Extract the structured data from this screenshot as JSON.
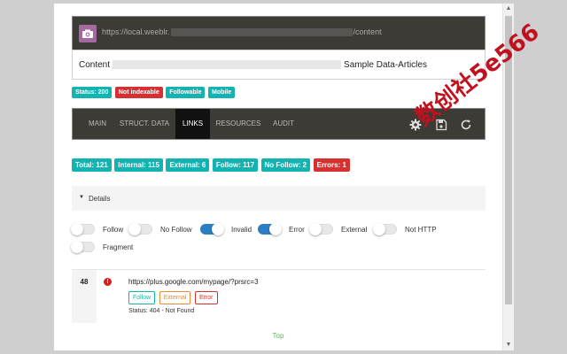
{
  "address": {
    "prefix": "https://local.weeblr.",
    "suffix": "/content"
  },
  "page_title": {
    "prefix": "Content",
    "suffix": "Sample Data-Articles"
  },
  "status_badges": [
    {
      "label": "Status: 200",
      "color": "#12b3b0"
    },
    {
      "label": "Not indexable",
      "color": "#d73030"
    },
    {
      "label": "Followable",
      "color": "#12b3b0"
    },
    {
      "label": "Mobile",
      "color": "#12b3b0"
    }
  ],
  "tabs": [
    {
      "label": "MAIN"
    },
    {
      "label": "STRUCT. DATA"
    },
    {
      "label": "LINKS"
    },
    {
      "label": "RESOURCES"
    },
    {
      "label": "AUDIT"
    }
  ],
  "active_tab": "LINKS",
  "toolbar_icons": [
    "gear-icon",
    "save-icon",
    "refresh-icon"
  ],
  "stats": [
    {
      "label": "Total: 121",
      "color": "#12b3b0"
    },
    {
      "label": "Internal: 115",
      "color": "#12b3b0"
    },
    {
      "label": "External: 6",
      "color": "#12b3b0"
    },
    {
      "label": "Follow: 117",
      "color": "#12b3b0"
    },
    {
      "label": "No Follow: 2",
      "color": "#12b3b0"
    },
    {
      "label": "Errors: 1",
      "color": "#d73030"
    }
  ],
  "details": {
    "label": "Details"
  },
  "filters": [
    {
      "label": "Follow",
      "on": false
    },
    {
      "label": "No Follow",
      "on": false
    },
    {
      "label": "Invalid",
      "on": true
    },
    {
      "label": "Error",
      "on": true
    },
    {
      "label": "External",
      "on": false
    },
    {
      "label": "Not HTTP",
      "on": false
    },
    {
      "label": "Fragment",
      "on": false
    }
  ],
  "link_rows": [
    {
      "line": "48",
      "url": "https://plus.google.com/mypage/?prsrc=3",
      "tags": [
        "Follow",
        "External",
        "Error"
      ],
      "status": "Status: 404 - Not Found"
    }
  ],
  "footer": {
    "top_label": "Top"
  },
  "watermark": "数创社5e566"
}
